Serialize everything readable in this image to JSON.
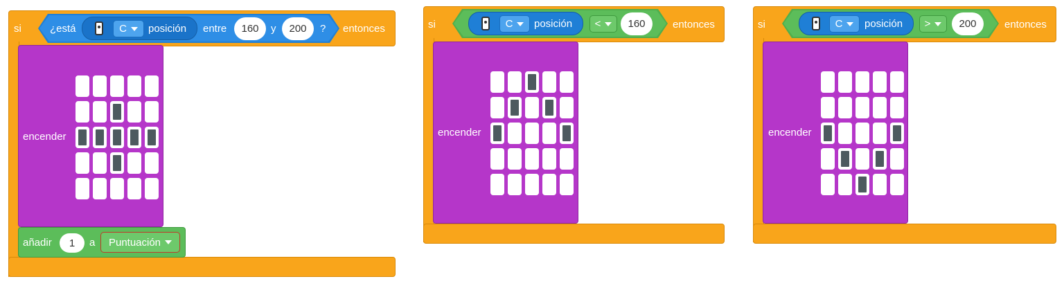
{
  "colors": {
    "control": "#f9a51b",
    "led_block": "#b536c9",
    "logic": "#5cbd5a",
    "sensor": "#1f8ae0",
    "led_on": "#4d5a5f"
  },
  "blocks": [
    {
      "if_kw": "si",
      "then_kw": "entonces",
      "condition": {
        "type": "between",
        "prefix": "¿está",
        "remote_icon": "remote-icon",
        "button": "C",
        "position_label": "posición",
        "between_label": "entre",
        "low": "160",
        "and_label": "y",
        "high": "200",
        "question": "?"
      },
      "led_label": "encender",
      "led": [
        [
          0,
          0,
          0,
          0,
          0
        ],
        [
          0,
          0,
          1,
          0,
          0
        ],
        [
          1,
          1,
          1,
          1,
          1
        ],
        [
          0,
          0,
          1,
          0,
          0
        ],
        [
          0,
          0,
          0,
          0,
          0
        ]
      ],
      "add": {
        "label": "añadir",
        "value": "1",
        "to": "a",
        "variable": "Puntuación"
      }
    },
    {
      "if_kw": "si",
      "then_kw": "entonces",
      "condition": {
        "type": "compare",
        "remote_icon": "remote-icon",
        "button": "C",
        "position_label": "posición",
        "operator": "<",
        "value": "160"
      },
      "led_label": "encender",
      "led": [
        [
          0,
          0,
          1,
          0,
          0
        ],
        [
          0,
          1,
          0,
          1,
          0
        ],
        [
          1,
          0,
          0,
          0,
          1
        ],
        [
          0,
          0,
          0,
          0,
          0
        ],
        [
          0,
          0,
          0,
          0,
          0
        ]
      ]
    },
    {
      "if_kw": "si",
      "then_kw": "entonces",
      "condition": {
        "type": "compare",
        "remote_icon": "remote-icon",
        "button": "C",
        "position_label": "posición",
        "operator": ">",
        "value": "200"
      },
      "led_label": "encender",
      "led": [
        [
          0,
          0,
          0,
          0,
          0
        ],
        [
          0,
          0,
          0,
          0,
          0
        ],
        [
          1,
          0,
          0,
          0,
          1
        ],
        [
          0,
          1,
          0,
          1,
          0
        ],
        [
          0,
          0,
          1,
          0,
          0
        ]
      ]
    }
  ]
}
